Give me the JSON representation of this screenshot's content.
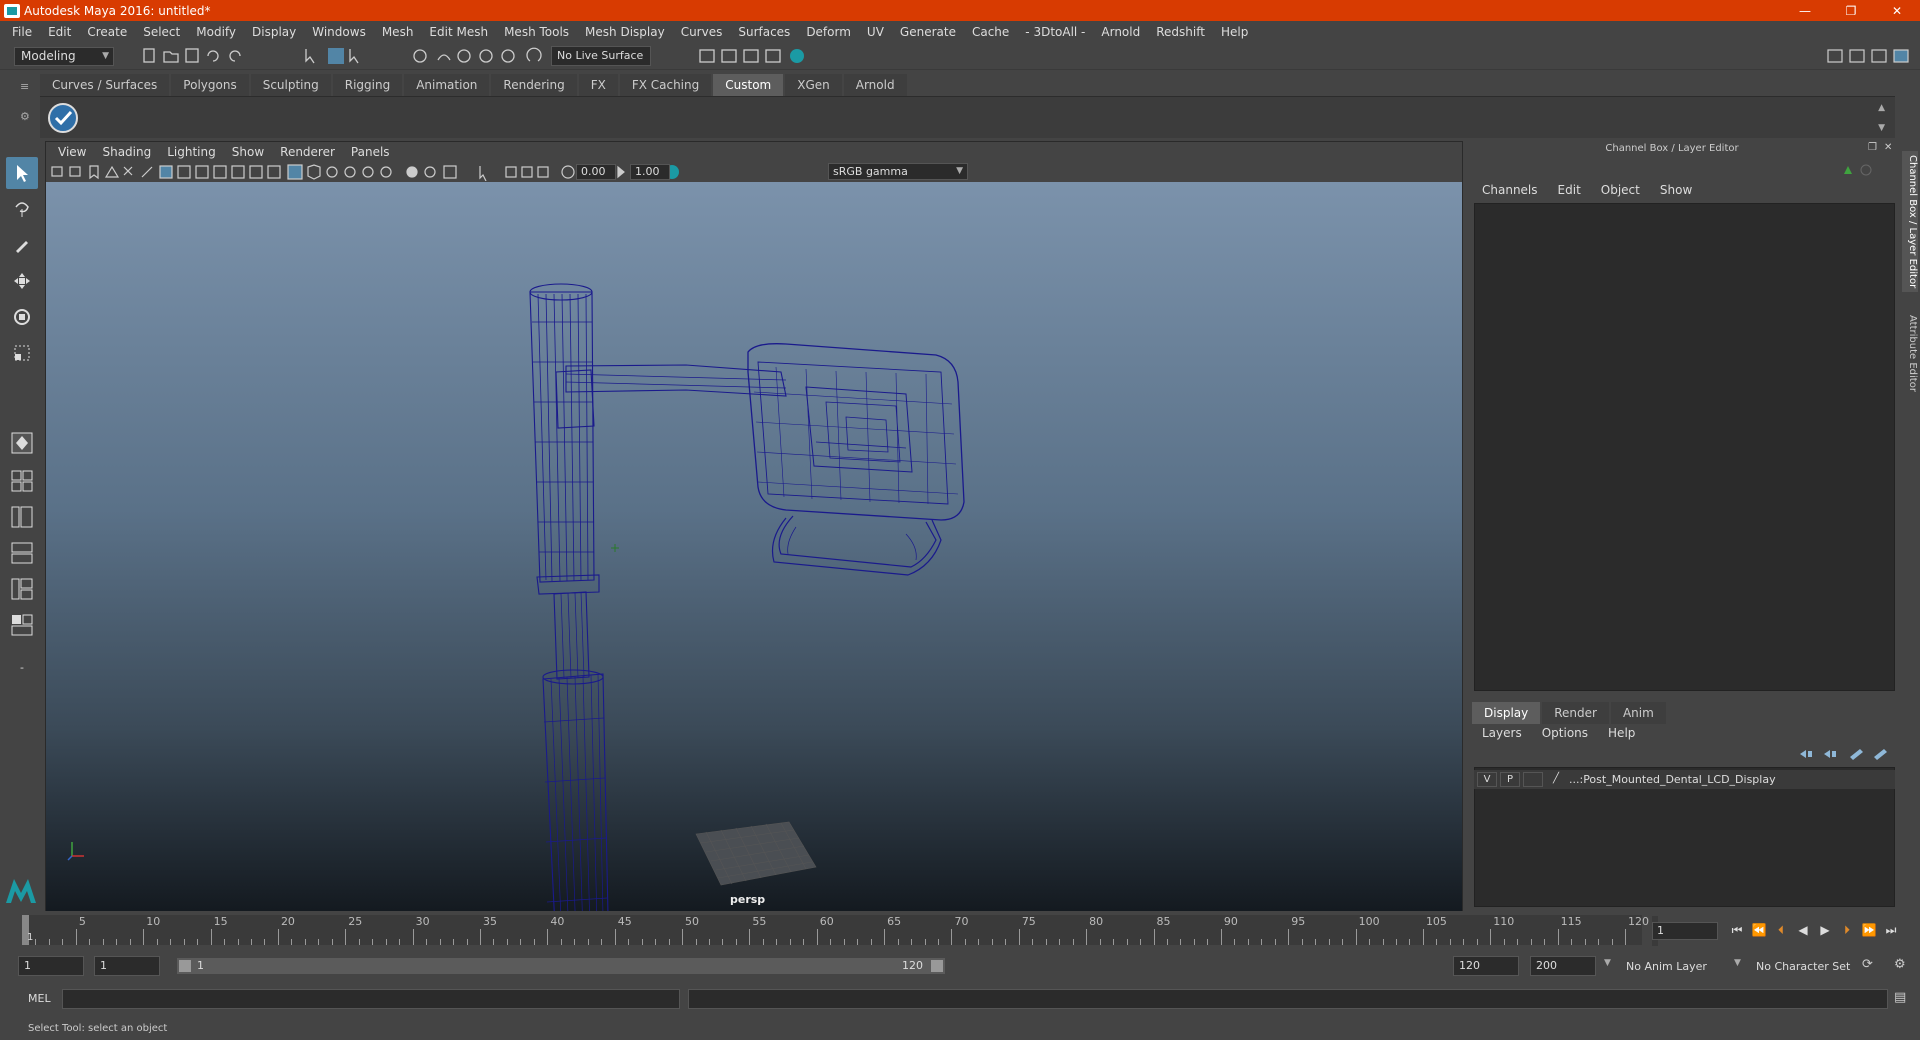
{
  "window": {
    "title": "Autodesk Maya 2016: untitled*",
    "minimize": "—",
    "restore": "❐",
    "close": "✕"
  },
  "menu": [
    "File",
    "Edit",
    "Create",
    "Select",
    "Modify",
    "Display",
    "Windows",
    "Mesh",
    "Edit Mesh",
    "Mesh Tools",
    "Mesh Display",
    "Curves",
    "Surfaces",
    "Deform",
    "UV",
    "Generate",
    "Cache",
    "- 3DtoAll -",
    "Arnold",
    "Redshift",
    "Help"
  ],
  "status": {
    "mode": "Modeling",
    "live_surface": "No Live Surface"
  },
  "shelf_tabs": [
    "Curves / Surfaces",
    "Polygons",
    "Sculpting",
    "Rigging",
    "Animation",
    "Rendering",
    "FX",
    "FX Caching",
    "Custom",
    "XGen",
    "Arnold"
  ],
  "shelf_active": "Custom",
  "viewport": {
    "menu": [
      "View",
      "Shading",
      "Lighting",
      "Show",
      "Renderer",
      "Panels"
    ],
    "exposure": "0.00",
    "gamma_value": "1.00",
    "color_space": "sRGB gamma",
    "camera": "persp"
  },
  "channel_box": {
    "title": "Channel Box / Layer Editor",
    "menu": [
      "Channels",
      "Edit",
      "Object",
      "Show"
    ]
  },
  "layer_editor": {
    "tabs": [
      "Display",
      "Render",
      "Anim"
    ],
    "active_tab": "Display",
    "menu": [
      "Layers",
      "Options",
      "Help"
    ],
    "layers": [
      {
        "v": "V",
        "p": "P",
        "name": "...:Post_Mounted_Dental_LCD_Display"
      }
    ]
  },
  "side_tabs": [
    "Channel Box / Layer Editor",
    "Attribute Editor"
  ],
  "timeline": {
    "labels": [
      "5",
      "10",
      "15",
      "20",
      "25",
      "30",
      "35",
      "40",
      "45",
      "50",
      "55",
      "60",
      "65",
      "70",
      "75",
      "80",
      "85",
      "90",
      "95",
      "100",
      "105",
      "110",
      "115",
      "120"
    ],
    "current_frame": "1",
    "start_marker": "1"
  },
  "range": {
    "start": "1",
    "playback_start": "1",
    "slider_start": "1",
    "slider_end": "120",
    "playback_end": "120",
    "end": "200",
    "anim_layer": "No Anim Layer",
    "character_set": "No Character Set"
  },
  "command": {
    "label": "MEL"
  },
  "statusbar": {
    "text": "Select Tool: select an object"
  },
  "colors": {
    "title_bar": "#d83b01",
    "wireframe": "#1a1a8c",
    "selection": "#5285a6"
  }
}
